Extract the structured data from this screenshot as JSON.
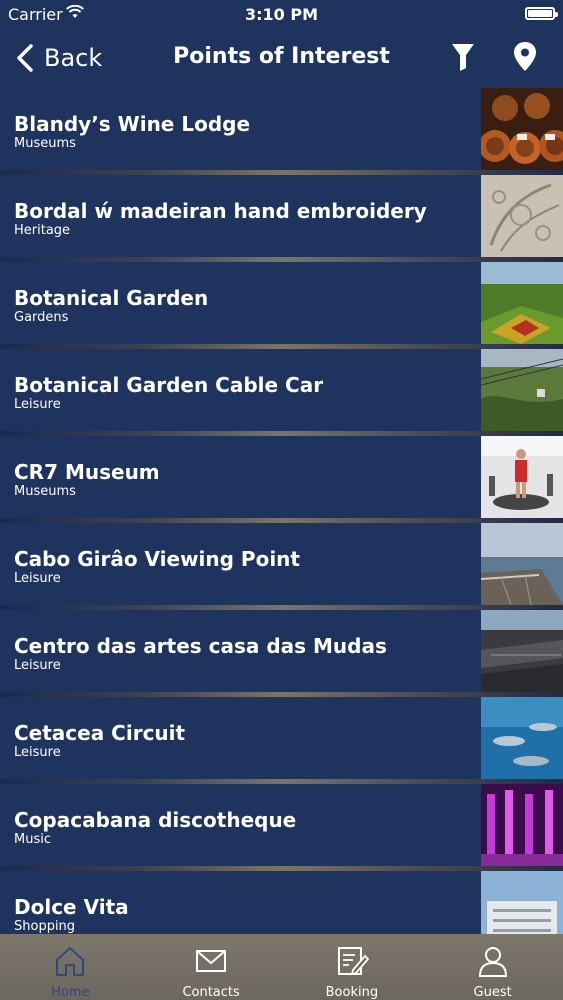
{
  "status": {
    "carrier": "Carrier",
    "time": "3:10 PM"
  },
  "nav": {
    "back_label": "Back",
    "title": "Points of Interest"
  },
  "items": [
    {
      "title": "Blandy’s Wine Lodge",
      "category": "Museums"
    },
    {
      "title": "Bordal ẃ madeiran hand embroidery",
      "category": "Heritage"
    },
    {
      "title": "Botanical Garden",
      "category": "Gardens"
    },
    {
      "title": "Botanical Garden Cable Car",
      "category": "Leisure"
    },
    {
      "title": "CR7 Museum",
      "category": "Museums"
    },
    {
      "title": "Cabo Girâo Viewing Point",
      "category": "Leisure"
    },
    {
      "title": "Centro das artes casa das Mudas",
      "category": "Leisure"
    },
    {
      "title": "Cetacea Circuit",
      "category": "Leisure"
    },
    {
      "title": "Copacabana discotheque",
      "category": "Music"
    },
    {
      "title": "Dolce Vita",
      "category": "Shopping"
    }
  ],
  "tabs": [
    {
      "label": "Home",
      "icon": "house-icon",
      "active": true
    },
    {
      "label": "Contacts",
      "icon": "envelope-icon",
      "active": false
    },
    {
      "label": "Booking",
      "icon": "edit-document-icon",
      "active": false
    },
    {
      "label": "Guest",
      "icon": "user-icon",
      "active": false
    }
  ],
  "colors": {
    "background": "#1f335f",
    "tab_bar": "#75705f",
    "active_tab": "#2b4a80"
  }
}
